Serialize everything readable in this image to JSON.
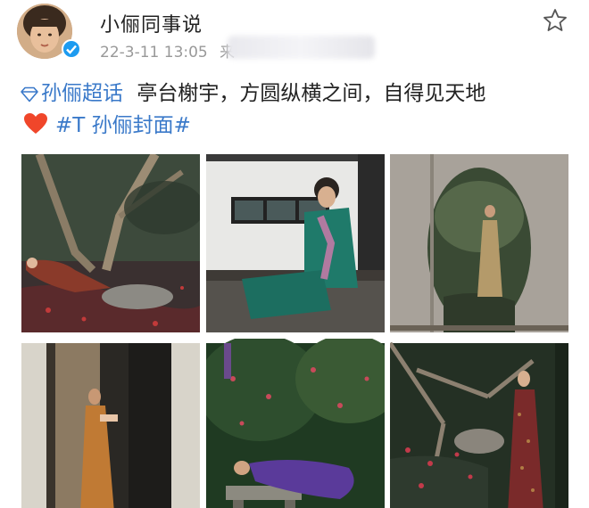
{
  "post": {
    "username": "小俪同事说",
    "timestamp": "22-3-11 13:05",
    "source_prefix": "来",
    "supertopic": "孙俪超话",
    "text": "亭台榭宇，方圆纵横之间，自得见天地",
    "hashtag": "#T 孙俪封面#"
  },
  "icons": [
    "avatar",
    "verified-badge-icon",
    "star-icon",
    "diamond-icon",
    "heart-icon"
  ],
  "colors": {
    "link": "#3a79c9",
    "verified": "#1d9bf0",
    "heart": "#f0462a"
  },
  "photos": [
    "garden-tree-woman-lying",
    "wall-green-suit-sitting",
    "moon-gate-woman-standing",
    "doorway-orange-dress",
    "flowers-bench-purple-dress",
    "garden-sequin-dress-standing"
  ]
}
